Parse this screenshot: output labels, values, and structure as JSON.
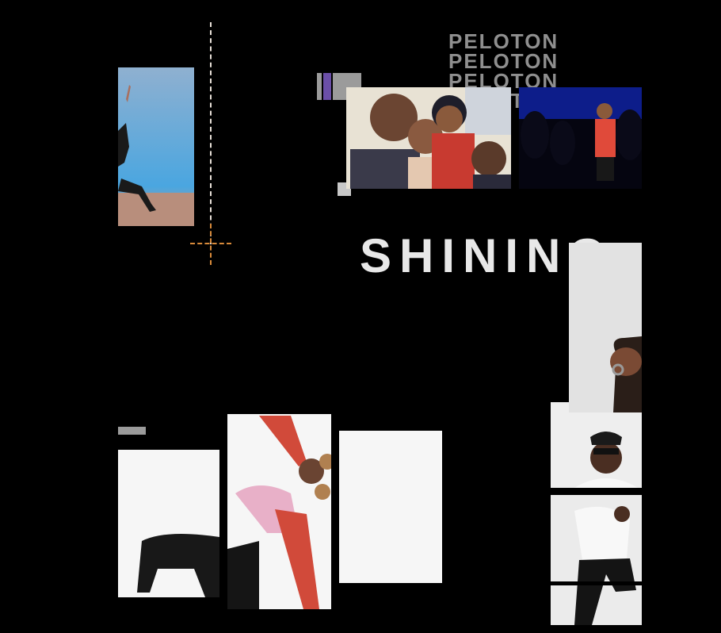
{
  "brand": {
    "lines": [
      "PELOTON",
      "PELOTON",
      "PELOTON",
      "PELOTON"
    ]
  },
  "headline": {
    "text": "SHINING"
  },
  "photos": [
    {
      "name": "dancer-blue-stage-photo"
    },
    {
      "name": "family-selfie-photo"
    },
    {
      "name": "instructor-stage-photo"
    },
    {
      "name": "hand-ring-closeup-photo"
    },
    {
      "name": "instructor-sunglasses-photo"
    },
    {
      "name": "dancer-red-top-photo"
    },
    {
      "name": "dancer-black-pants-photo"
    },
    {
      "name": "blank-white-panel"
    },
    {
      "name": "dancing-man-white-shirt-photo"
    }
  ],
  "colors": {
    "background": "#000000",
    "accent_orange": "#d88a3a",
    "accent_purple": "#6b4fa8",
    "headline": "#e8e8e8"
  }
}
